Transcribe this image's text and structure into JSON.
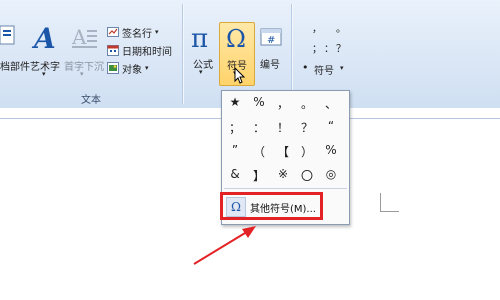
{
  "ribbon": {
    "text_group": {
      "label": "文本",
      "doc_parts_label": "档部件",
      "wordart_label": "艺术字",
      "dropcap_label": "首字下沉",
      "signature_line_label": "签名行",
      "date_time_label": "日期和时间",
      "object_label": "对象"
    },
    "symbols_group": {
      "equation_label": "公式",
      "symbol_label": "符号",
      "number_label": "编号"
    },
    "special_group": {
      "symbol_label": "符号",
      "glyphs": [
        "，",
        "。",
        "；",
        "：",
        "？"
      ]
    }
  },
  "symbol_dropdown": {
    "symbols": [
      "★",
      "%",
      "，",
      "。",
      "、",
      "；",
      "：",
      "！",
      "？",
      "“",
      "”",
      "（",
      "【",
      "）",
      "%",
      "&",
      "】",
      "※",
      "〇",
      "◎"
    ],
    "more_symbols_label": "其他符号(M)..."
  },
  "colors": {
    "accent": "#1c56a8",
    "highlight": "#ffd36b",
    "annotation_red": "#e32226"
  }
}
